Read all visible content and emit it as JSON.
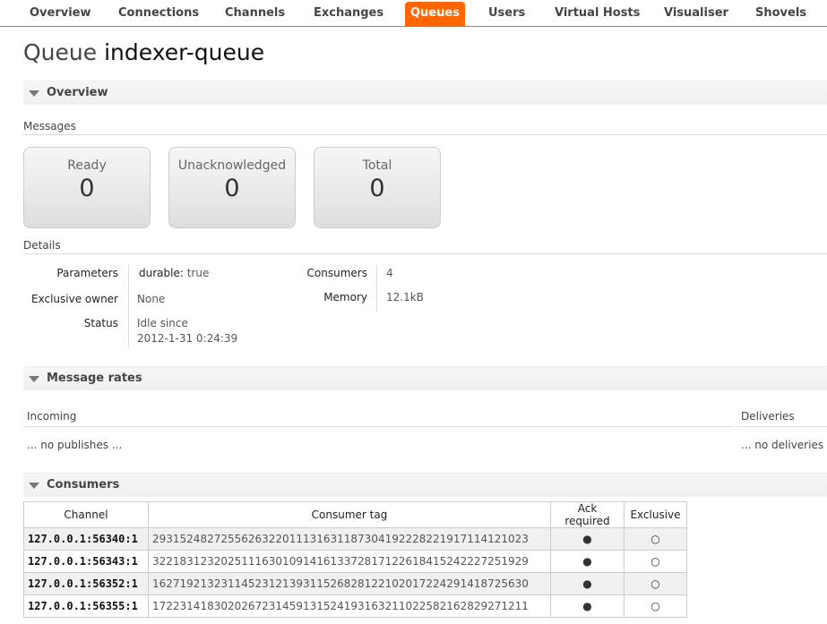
{
  "nav": [
    {
      "label": "Overview",
      "active": false
    },
    {
      "label": "Connections",
      "active": false
    },
    {
      "label": "Channels",
      "active": false
    },
    {
      "label": "Exchanges",
      "active": false
    },
    {
      "label": "Queues",
      "active": true
    },
    {
      "label": "Users",
      "active": false
    },
    {
      "label": "Virtual Hosts",
      "active": false
    },
    {
      "label": "Visualiser",
      "active": false
    },
    {
      "label": "Shovels",
      "active": false
    }
  ],
  "colors": {
    "accent": "#ff6600"
  },
  "page": {
    "title_prefix": "Queue",
    "queue_name": "indexer-queue"
  },
  "overview": {
    "header": "Overview",
    "messages_label": "Messages",
    "boxes": [
      {
        "label": "Ready",
        "value": "0"
      },
      {
        "label": "Unacknowledged",
        "value": "0"
      },
      {
        "label": "Total",
        "value": "0"
      }
    ],
    "details_label": "Details",
    "parameters_label": "Parameters",
    "parameters_key": "durable:",
    "parameters_value": "true",
    "exclusive_owner_label": "Exclusive owner",
    "exclusive_owner_value": "None",
    "status_label": "Status",
    "status_line1": "Idle since",
    "status_line2": "2012-1-31 0:24:39",
    "consumers_label": "Consumers",
    "consumers_value": "4",
    "memory_label": "Memory",
    "memory_value": "12.1kB"
  },
  "rates": {
    "header": "Message rates",
    "incoming_label": "Incoming",
    "incoming_empty": "... no publishes ...",
    "deliveries_label": "Deliveries",
    "deliveries_empty": "... no deliveries ..."
  },
  "consumers": {
    "header": "Consumers",
    "columns": [
      "Channel",
      "Consumer tag",
      "Ack required",
      "Exclusive"
    ],
    "ack_icon": "filled-dot-icon",
    "exclusive_icon": "hollow-dot-icon",
    "rows": [
      {
        "channel": "127.0.0.1:56340:1",
        "tag": "29315248272556263220111316311873041922282219171141210​23",
        "ack": "●",
        "exclusive": "○"
      },
      {
        "channel": "127.0.0.1:56343:1",
        "tag": "322183123202511163010914161337281712261841524222725192​9",
        "ack": "●",
        "exclusive": "○"
      },
      {
        "channel": "127.0.0.1:56352:1",
        "tag": "162719213231145231213931152682812210201722429141872563​0",
        "ack": "●",
        "exclusive": "○"
      },
      {
        "channel": "127.0.0.1:56355:1",
        "tag": "1722314183020267231459131524193163211022582162829271211",
        "ack": "●",
        "exclusive": "○"
      }
    ]
  }
}
